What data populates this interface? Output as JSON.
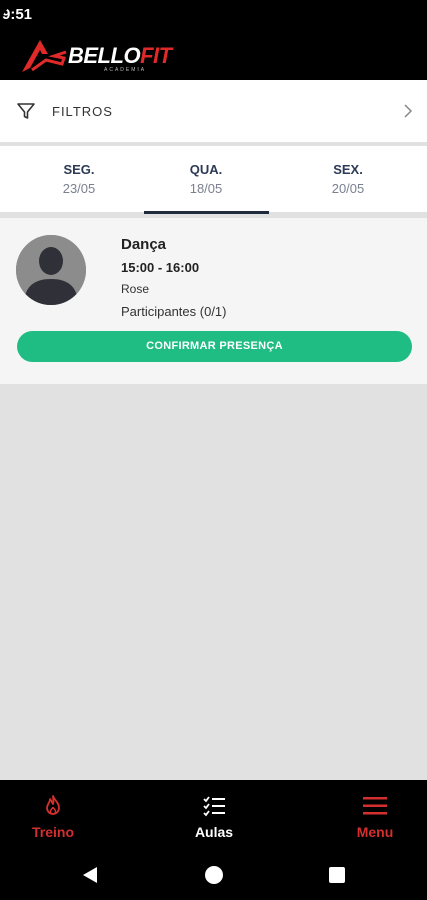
{
  "status_bar": {
    "time": "9:51"
  },
  "app": {
    "logo_text_a": "BELLO",
    "logo_text_b": "FIT",
    "logo_subtitle": "ACADEMIA"
  },
  "filters": {
    "label": "FILTROS"
  },
  "days": [
    {
      "name": "SEG.",
      "date": "23/05",
      "selected": false
    },
    {
      "name": "QUA.",
      "date": "18/05",
      "selected": true
    },
    {
      "name": "SEX.",
      "date": "20/05",
      "selected": false
    }
  ],
  "class_card": {
    "title": "Dança",
    "time": "15:00 - 16:00",
    "instructor": "Rose",
    "participants": "Participantes (0/1)",
    "confirm_label": "CONFIRMAR PRESENÇA"
  },
  "bottom_nav": [
    {
      "label": "Treino",
      "icon": "flame-icon",
      "color": "#d32f2f"
    },
    {
      "label": "Aulas",
      "icon": "checklist-icon",
      "color": "#ffffff"
    },
    {
      "label": "Menu",
      "icon": "hamburger-menu-icon",
      "color": "#d32f2f"
    }
  ],
  "colors": {
    "accent_green": "#1fbd84",
    "brand_red": "#e02a2a",
    "navy": "#2c3a55"
  }
}
